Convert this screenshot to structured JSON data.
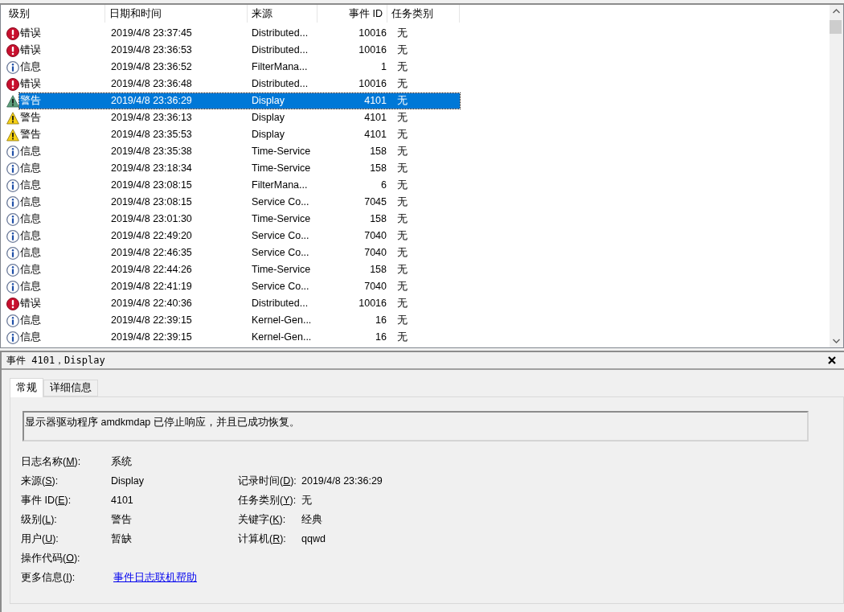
{
  "table": {
    "columns": [
      {
        "label": "级别"
      },
      {
        "label": "日期和时间"
      },
      {
        "label": "来源"
      },
      {
        "label": "事件 ID"
      },
      {
        "label": "任务类别"
      }
    ],
    "rows": [
      {
        "kind": "error",
        "level": "错误",
        "datetime": "2019/4/8 23:37:45",
        "source": "Distributed...",
        "event_id": "10016",
        "task": "无",
        "selected": false
      },
      {
        "kind": "error",
        "level": "错误",
        "datetime": "2019/4/8 23:36:53",
        "source": "Distributed...",
        "event_id": "10016",
        "task": "无",
        "selected": false
      },
      {
        "kind": "info",
        "level": "信息",
        "datetime": "2019/4/8 23:36:52",
        "source": "FilterMana...",
        "event_id": "1",
        "task": "无",
        "selected": false
      },
      {
        "kind": "error",
        "level": "错误",
        "datetime": "2019/4/8 23:36:48",
        "source": "Distributed...",
        "event_id": "10016",
        "task": "无",
        "selected": false
      },
      {
        "kind": "warning",
        "level": "警告",
        "datetime": "2019/4/8 23:36:29",
        "source": "Display",
        "event_id": "4101",
        "task": "无",
        "selected": true
      },
      {
        "kind": "warning",
        "level": "警告",
        "datetime": "2019/4/8 23:36:13",
        "source": "Display",
        "event_id": "4101",
        "task": "无",
        "selected": false
      },
      {
        "kind": "warning",
        "level": "警告",
        "datetime": "2019/4/8 23:35:53",
        "source": "Display",
        "event_id": "4101",
        "task": "无",
        "selected": false
      },
      {
        "kind": "info",
        "level": "信息",
        "datetime": "2019/4/8 23:35:38",
        "source": "Time-Service",
        "event_id": "158",
        "task": "无",
        "selected": false
      },
      {
        "kind": "info",
        "level": "信息",
        "datetime": "2019/4/8 23:18:34",
        "source": "Time-Service",
        "event_id": "158",
        "task": "无",
        "selected": false
      },
      {
        "kind": "info",
        "level": "信息",
        "datetime": "2019/4/8 23:08:15",
        "source": "FilterMana...",
        "event_id": "6",
        "task": "无",
        "selected": false
      },
      {
        "kind": "info",
        "level": "信息",
        "datetime": "2019/4/8 23:08:15",
        "source": "Service Co...",
        "event_id": "7045",
        "task": "无",
        "selected": false
      },
      {
        "kind": "info",
        "level": "信息",
        "datetime": "2019/4/8 23:01:30",
        "source": "Time-Service",
        "event_id": "158",
        "task": "无",
        "selected": false
      },
      {
        "kind": "info",
        "level": "信息",
        "datetime": "2019/4/8 22:49:20",
        "source": "Service Co...",
        "event_id": "7040",
        "task": "无",
        "selected": false
      },
      {
        "kind": "info",
        "level": "信息",
        "datetime": "2019/4/8 22:46:35",
        "source": "Service Co...",
        "event_id": "7040",
        "task": "无",
        "selected": false
      },
      {
        "kind": "info",
        "level": "信息",
        "datetime": "2019/4/8 22:44:26",
        "source": "Time-Service",
        "event_id": "158",
        "task": "无",
        "selected": false
      },
      {
        "kind": "info",
        "level": "信息",
        "datetime": "2019/4/8 22:41:19",
        "source": "Service Co...",
        "event_id": "7040",
        "task": "无",
        "selected": false
      },
      {
        "kind": "error",
        "level": "错误",
        "datetime": "2019/4/8 22:40:36",
        "source": "Distributed...",
        "event_id": "10016",
        "task": "无",
        "selected": false
      },
      {
        "kind": "info",
        "level": "信息",
        "datetime": "2019/4/8 22:39:15",
        "source": "Kernel-Gen...",
        "event_id": "16",
        "task": "无",
        "selected": false
      },
      {
        "kind": "info",
        "level": "信息",
        "datetime": "2019/4/8 22:39:15",
        "source": "Kernel-Gen...",
        "event_id": "16",
        "task": "无",
        "selected": false
      }
    ]
  },
  "detail": {
    "title": "事件 4101，Display",
    "tabs": [
      {
        "label": "常规",
        "selected": true
      },
      {
        "label": "详细信息",
        "selected": false
      }
    ],
    "message": "显示器驱动程序 amdkmdap 已停止响应，并且已成功恢复。",
    "rows": [
      {
        "fields": [
          {
            "label": {
              "before": "日志名称(",
              "key": "M",
              "after": "):"
            },
            "value": "系统",
            "kind": "text"
          }
        ]
      },
      {
        "fields": [
          {
            "label": {
              "before": "来源(",
              "key": "S",
              "after": "):"
            },
            "value": "Display",
            "kind": "text"
          },
          {
            "label": {
              "before": "记录时间(",
              "key": "D",
              "after": "):"
            },
            "value": "2019/4/8 23:36:29",
            "kind": "text"
          }
        ]
      },
      {
        "fields": [
          {
            "label": {
              "before": "事件 ID(",
              "key": "E",
              "after": "):"
            },
            "value": "4101",
            "kind": "text"
          },
          {
            "label": {
              "before": "任务类别(",
              "key": "Y",
              "after": "):"
            },
            "value": "无",
            "kind": "text"
          }
        ]
      },
      {
        "fields": [
          {
            "label": {
              "before": "级别(",
              "key": "L",
              "after": "):"
            },
            "value": "警告",
            "kind": "text"
          },
          {
            "label": {
              "before": "关键字(",
              "key": "K",
              "after": "):"
            },
            "value": "经典",
            "kind": "text"
          }
        ]
      },
      {
        "fields": [
          {
            "label": {
              "before": "用户(",
              "key": "U",
              "after": "):"
            },
            "value": "暂缺",
            "kind": "text"
          },
          {
            "label": {
              "before": "计算机(",
              "key": "R",
              "after": "):"
            },
            "value": "qqwd",
            "kind": "text"
          }
        ]
      },
      {
        "fields": [
          {
            "label": {
              "before": "操作代码(",
              "key": "O",
              "after": "):"
            }
          }
        ]
      },
      {
        "fields": [
          {
            "label": {
              "before": "更多信息(",
              "key": "I",
              "after": "):"
            },
            "value": "事件日志联机帮助",
            "kind": "link"
          }
        ]
      }
    ]
  }
}
